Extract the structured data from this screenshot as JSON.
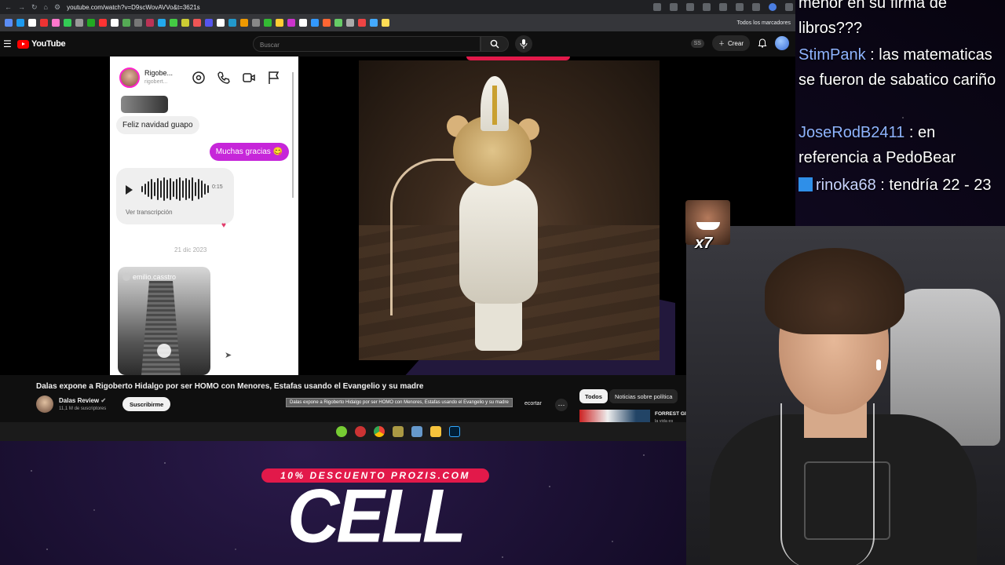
{
  "browser": {
    "url": "youtube.com/watch?v=D9scWovAVVo&t=3621s",
    "bookmarks_all_label": "Todos los marcadores"
  },
  "youtube": {
    "logo_text": "YouTube",
    "search_placeholder": "Buscar",
    "ss_badge": "SS",
    "create_label": "Crear"
  },
  "video_content": {
    "chat_name": "Rigobe...",
    "chat_handle": "rigobert...",
    "msg_in": "Feliz navidad guapo",
    "msg_out": "Muchas gracias 😋",
    "voice_duration": "0:15",
    "voice_transcript": "Ver transcripción",
    "date_label": "21 dic 2023",
    "reel_user": "emilio.casstro"
  },
  "video_info": {
    "title": "Dalas expone a Rigoberto Hidalgo por ser HOMO con Menores, Estafas usando el Evangelio y su madre",
    "channel_name": "Dalas Review",
    "subscribers": "11,1 M de suscriptores",
    "subscribe_label": "Suscribirme",
    "tooltip": "Dalas expone a Rigoberto Hidalgo por ser HOMO con Menores, Estafas usando el Evangelio y su madre",
    "clip_label": "ecortar",
    "chips": [
      "Todos",
      "Noticias sobre política"
    ],
    "rec_title": "FORREST GI",
    "rec_sub": "la vida es"
  },
  "stream_chat": [
    {
      "user": "",
      "text": "menor en su firma de libros???"
    },
    {
      "user": "StimPank",
      "text": ": las matematicas se fueron de sabatico cariño",
      "color": "#8fb4ff"
    },
    {
      "user": "JoseRodB2411",
      "text": ": en referencia a PedoBear",
      "color": "#8fb4ff"
    },
    {
      "user": "rinoka68",
      "text": ": tendría 22 - 23",
      "color": "#c8d4ff"
    }
  ],
  "emote": {
    "count": "x7"
  },
  "promo": {
    "discount": "10% DESCUENTO PROZIS.COM",
    "code": "CELL"
  },
  "colors": {
    "accent": "#e2194a",
    "youtube_red": "#ff0000",
    "chat_bubble_out": "#c626d9"
  }
}
